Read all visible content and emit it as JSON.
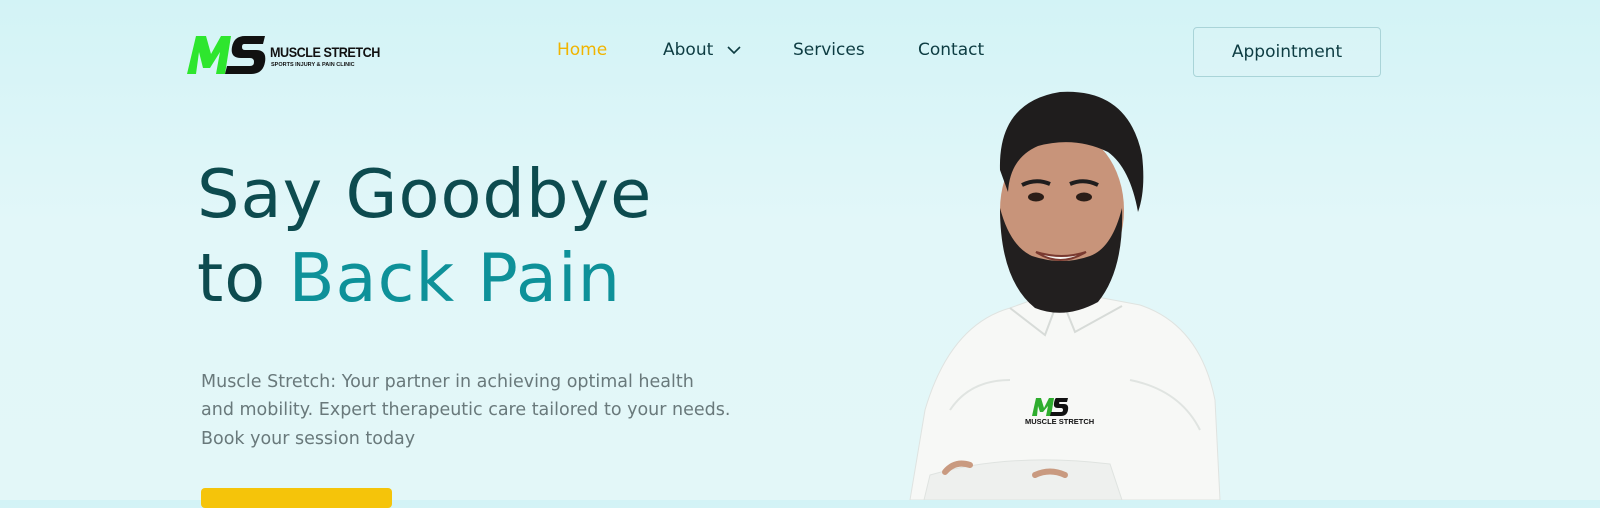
{
  "brand": {
    "logo_text": "MUSCLE STRETCH",
    "logo_subtext": "SPORTS INJURY & PAIN CLINIC",
    "primary_color": "#2ee62e"
  },
  "nav": {
    "items": [
      {
        "label": "Home",
        "active": true
      },
      {
        "label": "About",
        "has_dropdown": true
      },
      {
        "label": "Services"
      },
      {
        "label": "Contact"
      }
    ],
    "appointment_label": "Appointment"
  },
  "hero": {
    "headline_line1": "Say Goodbye",
    "headline_line2_prefix": "to",
    "headline_highlight": "Back Pain",
    "description": "Muscle Stretch: Your partner in achieving optimal health and mobility. Expert therapeutic care tailored to your needs. Book your session today",
    "cta_color": "#f5c40a"
  },
  "photo": {
    "shirt_logo_text": "MUSCLE STRETCH"
  }
}
